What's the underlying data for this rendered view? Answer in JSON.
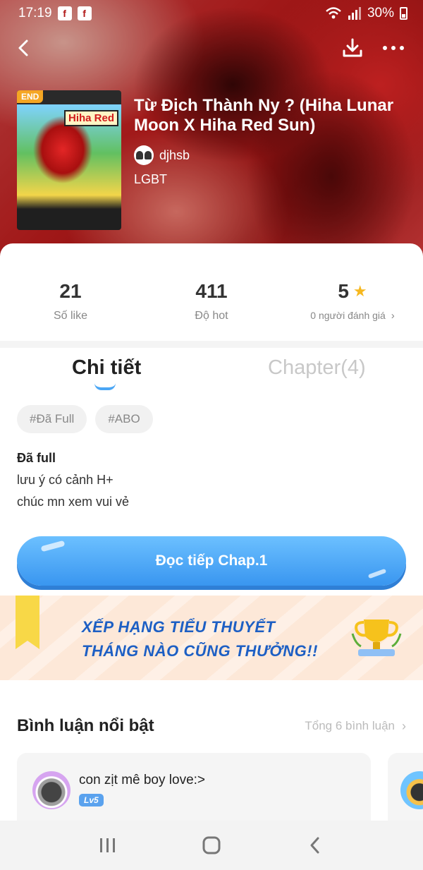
{
  "status_bar": {
    "time": "17:19",
    "notif_icon_1": "facebook-icon",
    "notif_icon_2": "facebook-icon",
    "battery": "30%"
  },
  "hero": {
    "cover_badge": "END",
    "cover_title": "Hiha Red",
    "title": "Từ Địch Thành Ny ? (Hiha Lunar Moon X Hiha Red Sun)",
    "author": "djhsb",
    "genre": "LGBT"
  },
  "stats": [
    {
      "value": "21",
      "label": "Số like"
    },
    {
      "value": "411",
      "label": "Độ hot"
    },
    {
      "value": "5",
      "label": "0 người đánh giá"
    }
  ],
  "tabs": {
    "details": "Chi tiết",
    "chapters": "Chapter(4)"
  },
  "tags": [
    "#Đã Full",
    "#ABO"
  ],
  "description": {
    "title": "Đã full",
    "line1": "lưu ý có cảnh H+",
    "line2": "chúc mn xem vui vẻ"
  },
  "read_button": "Đọc tiếp Chap.1",
  "banner": {
    "line1": "XẾP HẠNG TIỂU THUYẾT",
    "line2": "THÁNG NÀO CŨNG THƯỞNG!!"
  },
  "comments": {
    "title": "Bình luận nổi bật",
    "total": "Tổng 6 bình luận",
    "items": [
      {
        "user": "con zịt mê boy love:>",
        "level": "Lv5"
      }
    ]
  },
  "colors": {
    "accent": "#4aa6f5",
    "star": "#f6b81f",
    "end_badge": "#f5a623",
    "banner_text": "#1d5fc4"
  }
}
